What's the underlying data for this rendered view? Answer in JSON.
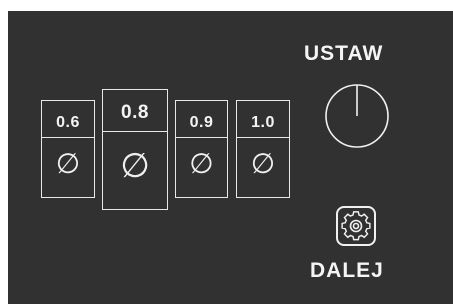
{
  "panel": {
    "diameter_symbol": "∅",
    "sizes": [
      {
        "label": "0.6",
        "selected": false
      },
      {
        "label": "0.8",
        "selected": true
      },
      {
        "label": "0.9",
        "selected": false
      },
      {
        "label": "1.0",
        "selected": false
      }
    ],
    "set_label": "USTAW",
    "next_label": "DALEJ",
    "knob_icon": "dial-knob",
    "gear_icon": "gear-icon"
  },
  "colors": {
    "background": "#313131",
    "foreground": "#f2f2f2"
  }
}
